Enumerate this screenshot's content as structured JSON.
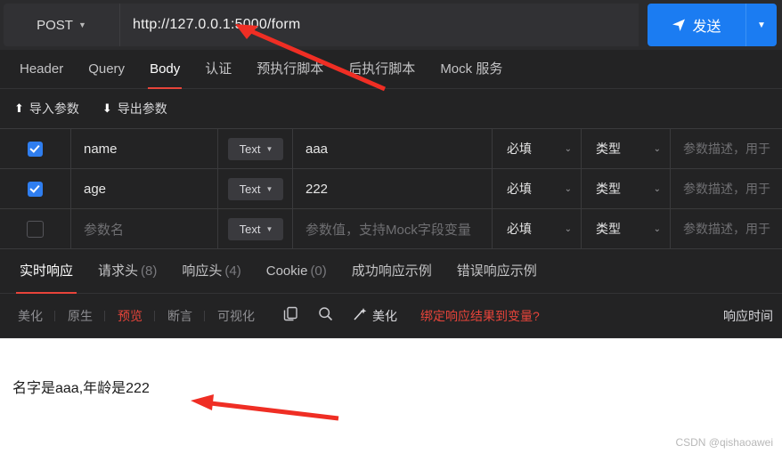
{
  "request": {
    "method": "POST",
    "url": "http://127.0.0.1:5000/form",
    "send_label": "发送",
    "send_icon": "paper-plane-icon",
    "send_split_icon": "chevron-down-icon"
  },
  "tabs": [
    {
      "label": "Header",
      "active": false
    },
    {
      "label": "Query",
      "active": false
    },
    {
      "label": "Body",
      "active": true
    },
    {
      "label": "认证",
      "active": false
    },
    {
      "label": "预执行脚本",
      "active": false
    },
    {
      "label": "后执行脚本",
      "active": false
    },
    {
      "label": "Mock 服务",
      "active": false
    }
  ],
  "io_bar": {
    "import_label": "导入参数",
    "export_label": "导出参数",
    "import_icon": "arrow-up-icon",
    "export_icon": "arrow-down-icon"
  },
  "params_table": {
    "type_label": "Text",
    "required_label": "必填",
    "kind_label": "类型",
    "name_placeholder": "参数名",
    "value_placeholder": "参数值，支持Mock字段变量",
    "desc_placeholder": "参数描述，用于",
    "rows": [
      {
        "checked": true,
        "name": "name",
        "type": "Text",
        "value": "aaa",
        "required": "必填",
        "kind": "类型",
        "desc": "参数描述，用于"
      },
      {
        "checked": true,
        "name": "age",
        "type": "Text",
        "value": "222",
        "required": "必填",
        "kind": "类型",
        "desc": "参数描述，用于"
      },
      {
        "checked": false,
        "name": "参数名",
        "type": "Text",
        "value": "参数值，支持Mock字段变量",
        "required": "必填",
        "kind": "类型",
        "desc": "参数描述，用于"
      }
    ]
  },
  "response_tabs": [
    {
      "label": "实时响应",
      "count": "",
      "active": true
    },
    {
      "label": "请求头",
      "count": "(8)",
      "active": false
    },
    {
      "label": "响应头",
      "count": "(4)",
      "active": false
    },
    {
      "label": "Cookie",
      "count": "(0)",
      "active": false
    },
    {
      "label": "成功响应示例",
      "count": "",
      "active": false
    },
    {
      "label": "错误响应示例",
      "count": "",
      "active": false
    }
  ],
  "response_toolbar": {
    "segments": [
      {
        "label": "美化",
        "active": false
      },
      {
        "label": "原生",
        "active": false
      },
      {
        "label": "预览",
        "active": true
      },
      {
        "label": "断言",
        "active": false
      },
      {
        "label": "可视化",
        "active": false
      }
    ],
    "copy_icon": "copy-icon",
    "search_icon": "search-icon",
    "beautify_icon": "wand-icon",
    "beautify_label": "美化",
    "bind_label": "绑定响应结果到变量?",
    "response_time_label": "响应时间"
  },
  "result": {
    "text": "名字是aaa,年龄是222",
    "watermark": "CSDN @qishaoawei"
  },
  "colors": {
    "accent_red": "#e8443a",
    "primary_blue": "#1b7cf2",
    "panel_bg": "#232324",
    "annotation_red": "#ef2e24"
  }
}
